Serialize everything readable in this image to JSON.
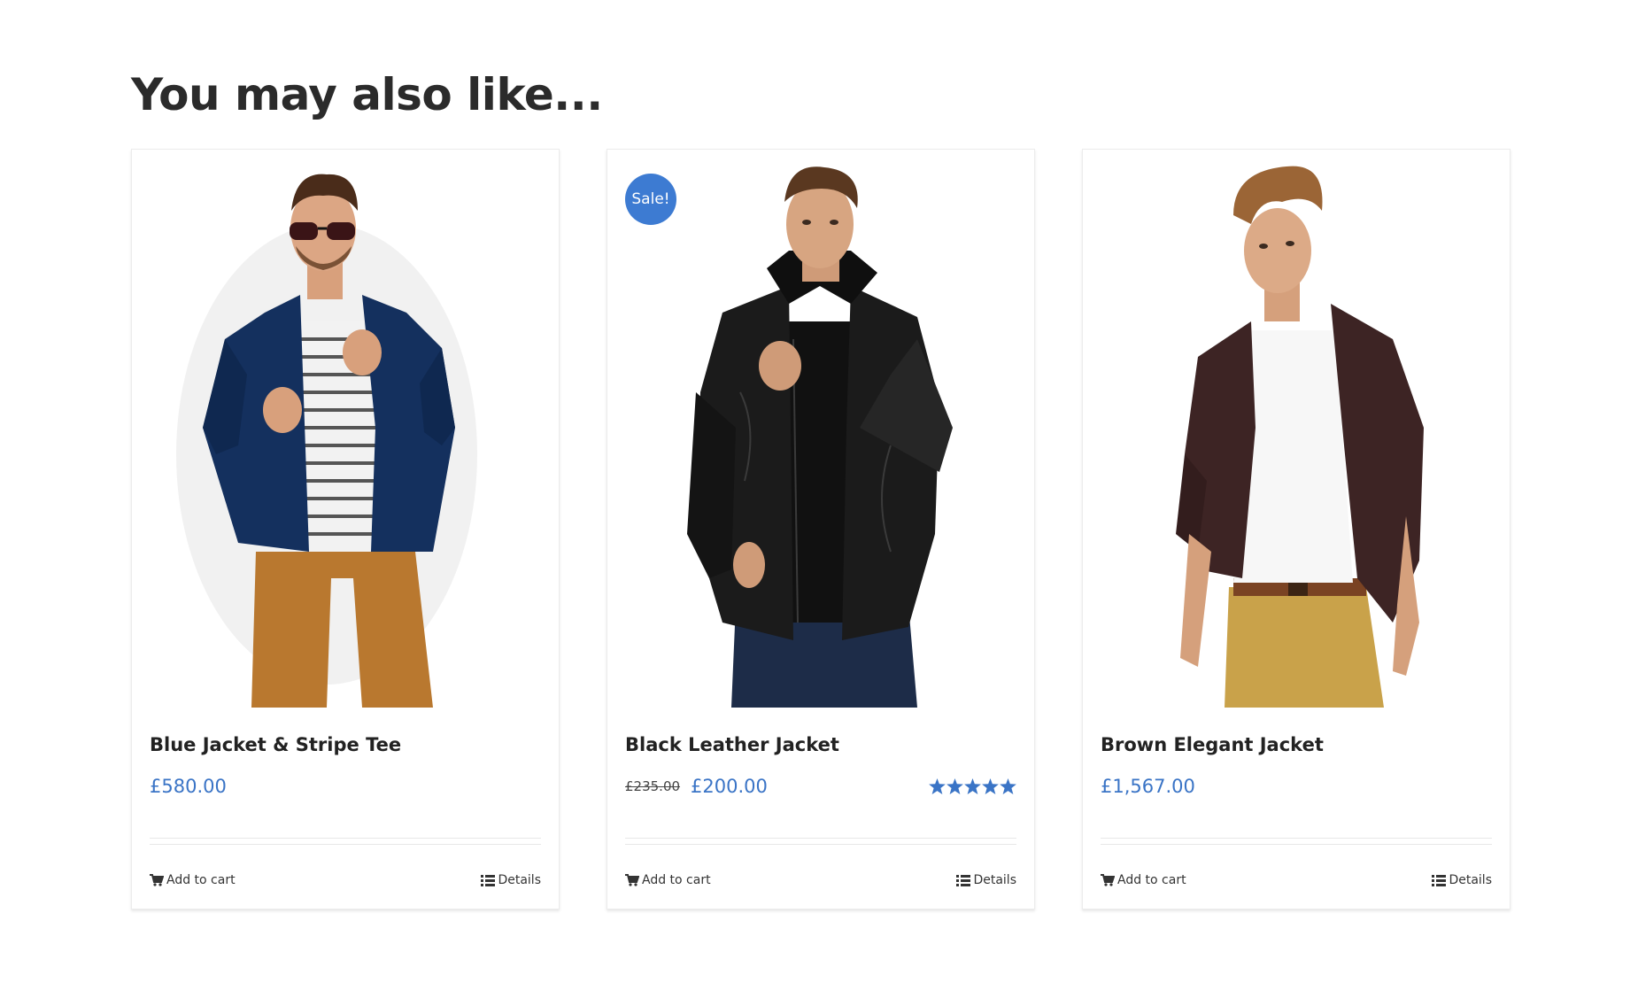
{
  "section": {
    "title": "You may also like..."
  },
  "products": [
    {
      "name": "Blue Jacket & Stripe Tee",
      "price": "£580.00",
      "add_to_cart_label": "Add to cart",
      "details_label": "Details",
      "image": "man-blue-jacket-sunglasses"
    },
    {
      "name": "Black Leather Jacket",
      "price": "£200.00",
      "old_price": "£235.00",
      "badge": "Sale!",
      "rating": 5,
      "rating_max": 5,
      "add_to_cart_label": "Add to cart",
      "details_label": "Details",
      "image": "man-black-leather-jacket"
    },
    {
      "name": "Brown Elegant Jacket",
      "price": "£1,567.00",
      "add_to_cart_label": "Add to cart",
      "details_label": "Details",
      "image": "man-brown-blazer"
    }
  ],
  "colors": {
    "accent": "#3a74c6",
    "badge": "#3d7bd2",
    "title": "#2b2b2b"
  },
  "icons": {
    "cart": "cart-icon",
    "details": "list-icon",
    "star": "star-icon"
  }
}
